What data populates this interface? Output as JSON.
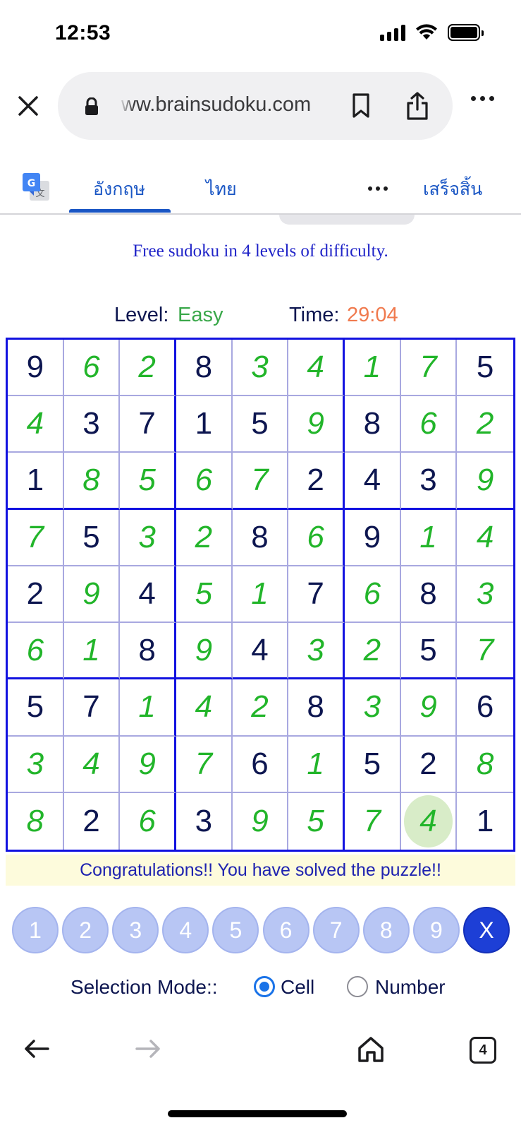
{
  "status": {
    "time": "12:53"
  },
  "browser": {
    "url": "ww.brainsudoku.com",
    "tabs_count": "4"
  },
  "translate": {
    "lang_source": "อังกฤษ",
    "lang_target": "ไทย",
    "done_label": "เสร็จสิ้น"
  },
  "page": {
    "subtitle": "Free sudoku in 4 levels of difficulty.",
    "level_label": "Level:",
    "level_value": "Easy",
    "time_label": "Time:",
    "time_value": "29:04",
    "congrats": "Congratulations!! You have solved the puzzle!!"
  },
  "board": {
    "digits": [
      [
        9,
        6,
        2,
        8,
        3,
        4,
        1,
        7,
        5
      ],
      [
        4,
        3,
        7,
        1,
        5,
        9,
        8,
        6,
        2
      ],
      [
        1,
        8,
        5,
        6,
        7,
        2,
        4,
        3,
        9
      ],
      [
        7,
        5,
        3,
        2,
        8,
        6,
        9,
        1,
        4
      ],
      [
        2,
        9,
        4,
        5,
        1,
        7,
        6,
        8,
        3
      ],
      [
        6,
        1,
        8,
        9,
        4,
        3,
        2,
        5,
        7
      ],
      [
        5,
        7,
        1,
        4,
        2,
        8,
        3,
        9,
        6
      ],
      [
        3,
        4,
        9,
        7,
        6,
        1,
        5,
        2,
        8
      ],
      [
        8,
        2,
        6,
        3,
        9,
        5,
        7,
        4,
        1
      ]
    ],
    "given": [
      [
        1,
        0,
        0,
        1,
        0,
        0,
        0,
        0,
        1
      ],
      [
        0,
        1,
        1,
        1,
        1,
        0,
        1,
        0,
        0
      ],
      [
        1,
        0,
        0,
        0,
        0,
        1,
        1,
        1,
        0
      ],
      [
        0,
        1,
        0,
        0,
        1,
        0,
        1,
        0,
        0
      ],
      [
        1,
        0,
        1,
        0,
        0,
        1,
        0,
        1,
        0
      ],
      [
        0,
        0,
        1,
        0,
        1,
        0,
        0,
        1,
        0
      ],
      [
        1,
        1,
        0,
        0,
        0,
        1,
        0,
        0,
        1
      ],
      [
        0,
        0,
        0,
        0,
        1,
        0,
        1,
        1,
        0
      ],
      [
        0,
        1,
        0,
        1,
        0,
        0,
        0,
        0,
        1
      ]
    ],
    "selected": [
      8,
      7
    ],
    "colors": {
      "given": "#0d1650",
      "user": "#22b52a",
      "border": "#1212e0"
    }
  },
  "keypad": {
    "keys": [
      "1",
      "2",
      "3",
      "4",
      "5",
      "6",
      "7",
      "8",
      "9"
    ],
    "clear": "X"
  },
  "selection_mode": {
    "label": "Selection Mode::",
    "options": [
      "Cell",
      "Number"
    ],
    "selected": "Cell"
  }
}
